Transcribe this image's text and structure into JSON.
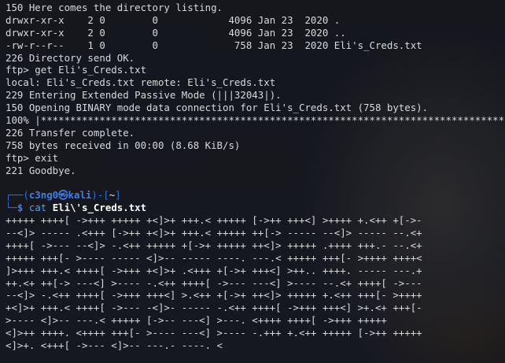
{
  "terminal": {
    "output_lines": [
      "150 Here comes the directory listing.",
      "drwxr-xr-x    2 0        0            4096 Jan 23  2020 .",
      "drwxr-xr-x    2 0        0            4096 Jan 23  2020 ..",
      "-rw-r--r--    1 0        0             758 Jan 23  2020 Eli's_Creds.txt",
      "226 Directory send OK.",
      "ftp> get Eli's_Creds.txt",
      "local: Eli's_Creds.txt remote: Eli's_Creds.txt",
      "229 Entering Extended Passive Mode (|||32043|).",
      "150 Opening BINARY mode data connection for Eli's_Creds.txt (758 bytes).",
      "100% |*********************************************************************************",
      "226 Transfer complete.",
      "758 bytes received in 00:00 (8.68 KiB/s)",
      "ftp> exit",
      "221 Goodbye."
    ],
    "prompt": {
      "top_left": "┌──(",
      "user": "c3ng0",
      "skull": "㉿",
      "host": "kali",
      "mid": ")-[",
      "path": "~",
      "end": "]",
      "bottom_left": "└─",
      "dollar": "$",
      "command_word": "cat",
      "command_arg": "Eli\\'s_Creds.txt"
    },
    "file_lines": [
      "+++++ ++++[ ->+++ +++++ +<]>+ +++.< +++++ [->++ +++<] >++++ +.<++ +[->-",
      "--<]> ----- .<+++ [->++ +<]>+ +++.< +++++ ++[-> ----- --<]> ----- --.<+",
      "++++[ ->--- --<]> -.<++ +++++ +[->+ +++++ ++<]> +++++ .++++ +++.- --.<+",
      "+++++ +++[- >---- ----- <]>-- ----- ----. ---.< +++++ +++[- >++++ ++++<",
      "]>+++ +++.< ++++[ ->+++ +<]>+ .<+++ +[->+ +++<] >++.. ++++. ----- ---.+",
      "++.<+ ++[-> ---<] >---- -.<++ ++++[ ->--- ---<] >---- --.<+ ++++[ ->---",
      "--<]> -.<++ ++++[ ->+++ +++<] >.<++ +[->+ ++<]> +++++ +.<++ +++[- >++++",
      "+<]>+ +++.< ++++[ ->--- -<]>- ----- -.<++ ++++[ ->+++ +++<] >+.<+ +++[-",
      ">---- <]>-- ---.< +++++ [->-- ---<] >---. <++++ ++++[ ->+++ +++++",
      "<]>++ ++++. <++++ +++[- >---- ---<] >---- -.+++ +.<++ +++++ [->++ +++++",
      "<]>+. <+++[ ->--- <]>-- ---.- ----. <"
    ]
  }
}
